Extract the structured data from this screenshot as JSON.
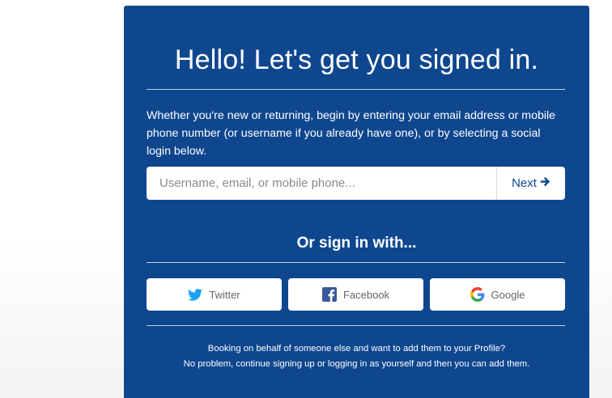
{
  "signin": {
    "title": "Hello! Let's get you signed in.",
    "intro": "Whether you're new or returning, begin by entering your email address or mobile phone number (or username if you already have one), or by selecting a social login below.",
    "input_placeholder": "Username, email, or mobile phone...",
    "input_value": "",
    "next_label": "Next",
    "or_sign_in": "Or sign in with...",
    "social": [
      {
        "label": "Twitter",
        "icon": "twitter-icon"
      },
      {
        "label": "Facebook",
        "icon": "facebook-icon"
      },
      {
        "label": "Google",
        "icon": "google-icon"
      }
    ],
    "footer_line1": "Booking on behalf of someone else and want to add them to your Profile?",
    "footer_line2": "No problem, continue signing up or logging in as yourself and then you can add them."
  },
  "colors": {
    "panel_bg": "#0f478f",
    "next_text": "#0f478f",
    "twitter": "#1da1f2",
    "facebook": "#3b5998"
  }
}
